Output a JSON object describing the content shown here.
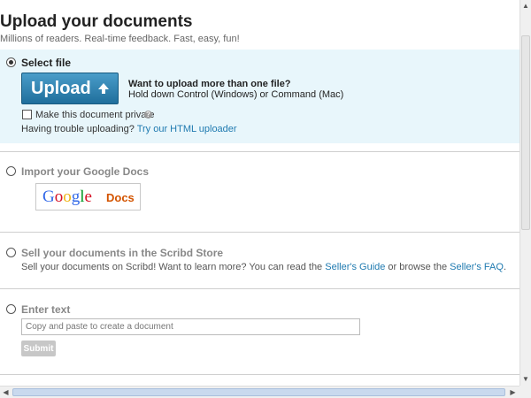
{
  "header": {
    "title": "Upload your documents",
    "subtitle": "Millions of readers. Real-time feedback. Fast, easy, fun!"
  },
  "select_file": {
    "heading": "Select file",
    "selected": true,
    "upload_label": "Upload",
    "upload_icon": "up-arrow-icon",
    "multi_title": "Want to upload more than one file?",
    "multi_hint": "Hold down Control (Windows) or Command (Mac)",
    "private_label": "Make this document private",
    "private_checked": false,
    "help_icon": "?",
    "trouble_text": "Having trouble uploading?",
    "html_uploader_link": "Try our HTML uploader"
  },
  "google_docs": {
    "heading": "Import your Google Docs",
    "logo_text": "Google",
    "logo_docs": "Docs"
  },
  "store": {
    "heading": "Sell your documents in the Scribd Store",
    "desc_before": "Sell your documents on Scribd! Want to learn more? You can read the ",
    "sellers_guide_link": "Seller's Guide",
    "desc_middle": " or browse the ",
    "sellers_faq_link": "Seller's FAQ",
    "desc_after": "."
  },
  "enter_text": {
    "heading": "Enter text",
    "placeholder": "Copy and paste to create a document",
    "submit_label": "Submit"
  },
  "colors": {
    "accent_link": "#1f7ab0",
    "upload_button": "#2a80b0",
    "selected_section_bg": "#e8f6fb"
  }
}
